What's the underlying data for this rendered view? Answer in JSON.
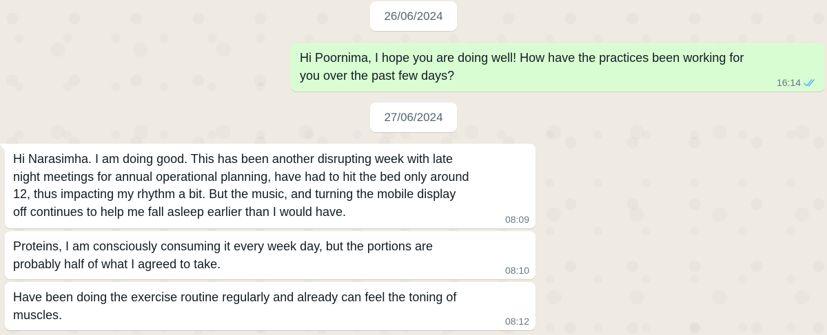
{
  "chat": {
    "dates": [
      "26/06/2024",
      "27/06/2024"
    ],
    "messages": [
      {
        "direction": "outgoing",
        "text": "Hi Poornima, I hope you are doing well! How have the practices been working for\nyou over the past few days?",
        "time": "16:14",
        "status_icon": "double-check-read-icon"
      },
      {
        "direction": "incoming",
        "text": "Hi Narasimha. I am doing good. This has been another disrupting week with late\nnight meetings for annual operational planning, have had to hit the bed only around\n12, thus impacting my rhythm a bit. But the music, and turning the mobile display\noff continues to help me fall asleep earlier than I would have.",
        "time": "08:09"
      },
      {
        "direction": "incoming",
        "text": "Proteins, I am consciously consuming  it every week day, but the portions are\nprobably half of what I agreed to take.",
        "time": "08:10"
      },
      {
        "direction": "incoming",
        "text": "Have been doing the exercise routine regularly and already can feel the toning of\nmuscles.",
        "time": "08:12"
      }
    ]
  },
  "colors": {
    "background": "#efeae2",
    "outgoing_bubble": "#d9fdd3",
    "incoming_bubble": "#ffffff",
    "read_ticks": "#53bdeb",
    "meta_text": "#667781"
  }
}
